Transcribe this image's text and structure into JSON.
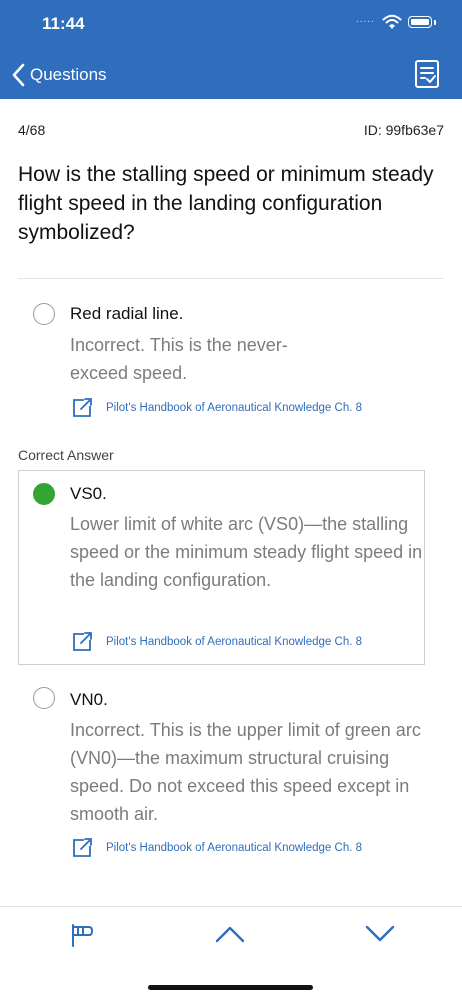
{
  "status_bar": {
    "time": "11:44",
    "signal_dots": "....."
  },
  "nav": {
    "back_label": "Questions"
  },
  "meta": {
    "progress": "4/68",
    "id": "ID: 99fb63e7"
  },
  "question": {
    "text": "How is the stalling speed or minimum steady flight speed in the landing configuration symbolized?"
  },
  "correct_answer_label": "Correct Answer",
  "options": [
    {
      "label": "Red radial line.",
      "explanation": "Incorrect. This is the never-exceed speed.",
      "reference": "Pilot's Handbook of Aeronautical Knowledge Ch. 8",
      "selected": false
    },
    {
      "label": "VS0.",
      "explanation": "Lower limit of white arc (VS0)—the stalling speed or the minimum steady flight speed in the landing configuration.",
      "reference": "Pilot's Handbook of Aeronautical Knowledge Ch. 8",
      "selected": true
    },
    {
      "label": "VN0.",
      "explanation": "Incorrect. This is the upper limit of green arc (VN0)—the maximum structural cruising speed. Do not exceed this speed except in smooth air.",
      "reference": "Pilot's Handbook of Aeronautical Knowledge Ch. 8",
      "selected": false
    }
  ],
  "toolbar": {
    "icons": [
      "flag-icon",
      "chevron-up-icon",
      "chevron-down-icon"
    ]
  },
  "colors": {
    "header": "#2f6ebd",
    "accent": "#2f6ebd",
    "correct": "#34a534",
    "explanation_text": "#7c7c7c"
  }
}
